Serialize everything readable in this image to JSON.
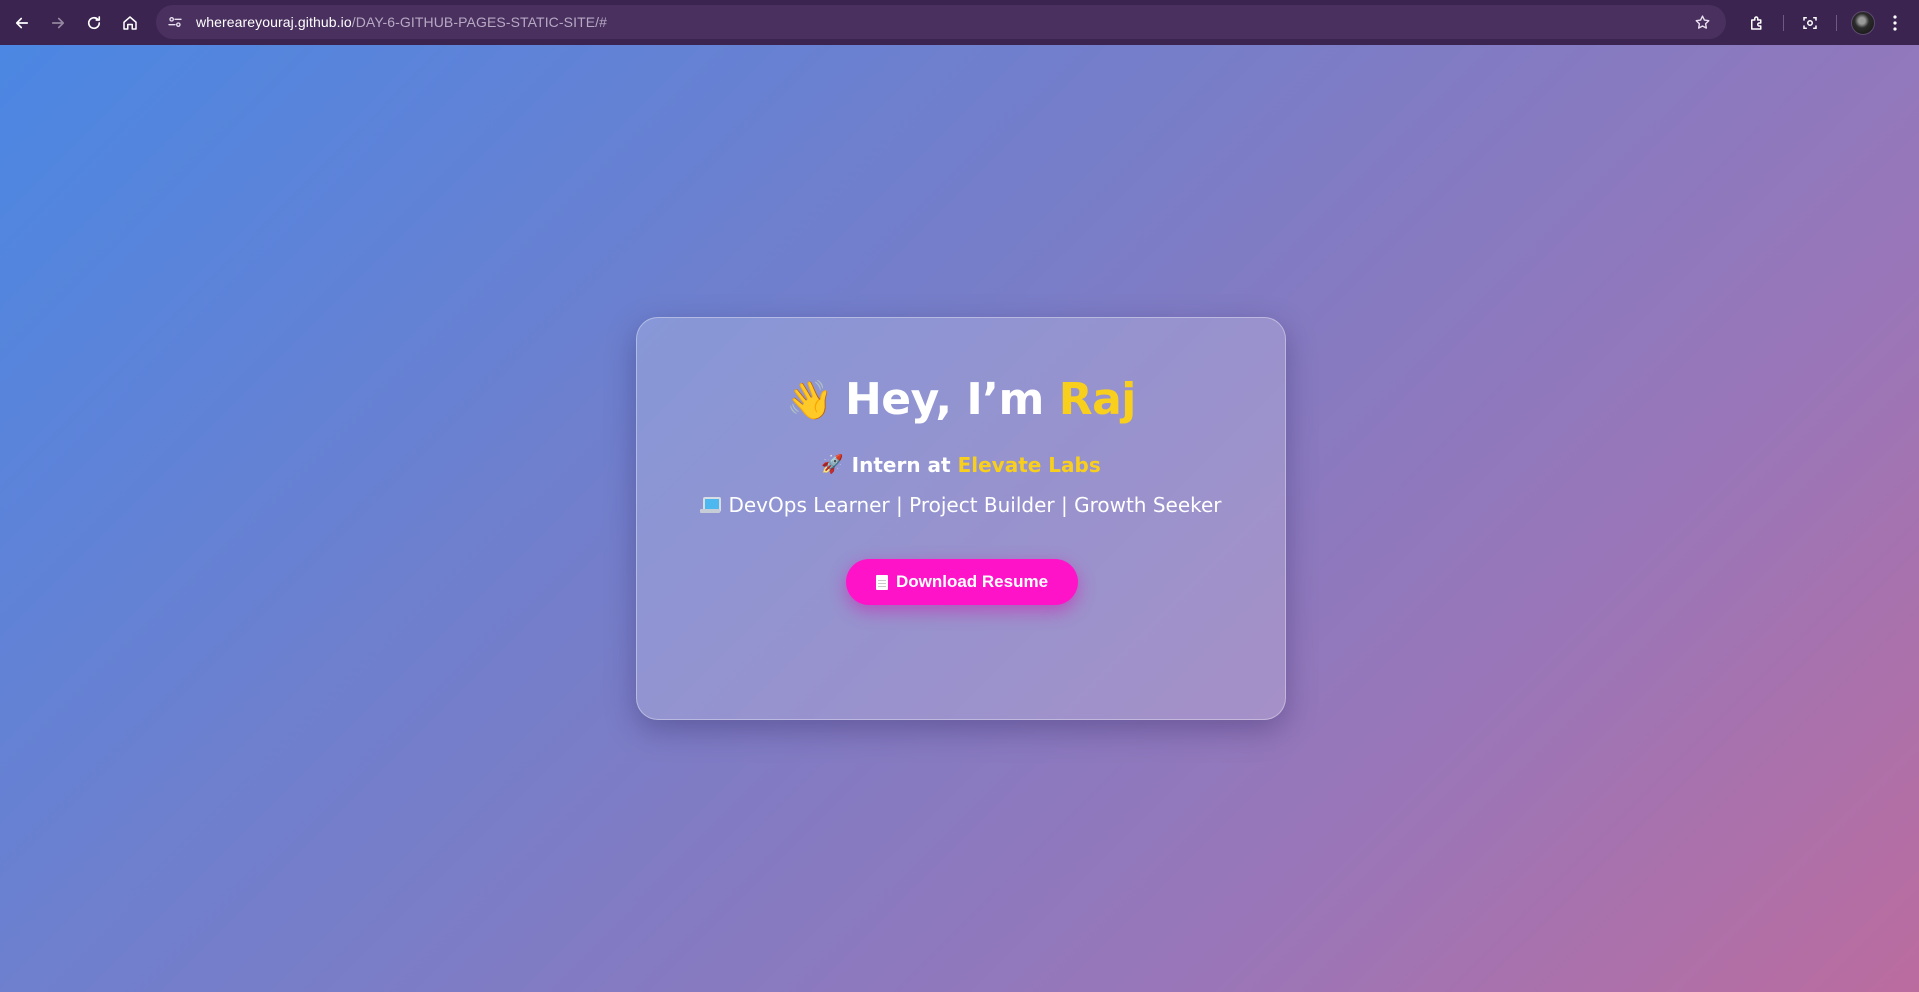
{
  "browser": {
    "url_host": "whereareyouraj.github.io",
    "url_path": "/DAY-6-GITHUB-PAGES-STATIC-SITE/#",
    "icons": [
      "back-icon",
      "forward-icon",
      "reload-icon",
      "home-icon",
      "site-info-icon",
      "star-icon",
      "extensions-icon",
      "screenshot-icon",
      "avatar",
      "menu-icon"
    ]
  },
  "hero": {
    "wave_emoji": "👋",
    "greeting": "Hey, I’m",
    "name": "Raj",
    "rocket_emoji": "🚀",
    "intern_prefix": "Intern at",
    "company": "Elevate Labs",
    "tagline": "DevOps Learner | Project Builder | Growth Seeker",
    "download_label": "Download Resume"
  },
  "colors": {
    "accent": "#f8cf1c",
    "button": "#ff13c8",
    "toolbar": "#3b2450"
  }
}
